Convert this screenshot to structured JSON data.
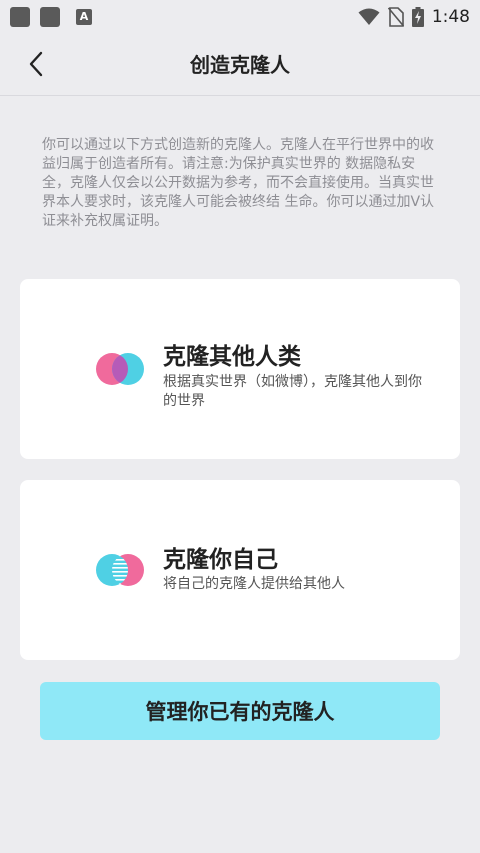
{
  "status_bar": {
    "time": "1:48",
    "notification_letter": "A"
  },
  "header": {
    "title": "创造克隆人"
  },
  "description": "你可以通过以下方式创造新的克隆人。克隆人在平行世界中的收益归属于创造者所有。请注意:为保护真实世界的 数据隐私安全，克隆人仅会以公开数据为参考，而不会直接使用。当真实世界本人要求时，该克隆人可能会被终结 生命。你可以通过加V认证来补充权属证明。",
  "options": [
    {
      "title": "克隆其他人类",
      "description": "根据真实世界（如微博），克隆其他人到你的世界",
      "icon": "pink-blue-overlap-icon"
    },
    {
      "title": "克隆你自己",
      "description": "将自己的克隆人提供给其他人",
      "icon": "blue-pink-striped-overlap-icon"
    }
  ],
  "manage_button": {
    "label": "管理你已有的克隆人"
  },
  "colors": {
    "background": "#ececef",
    "card": "#ffffff",
    "accent_button": "#8fe8f7",
    "pink": "#f06a9c",
    "cyan": "#4fd0e4",
    "overlap": "#b65bb8"
  }
}
